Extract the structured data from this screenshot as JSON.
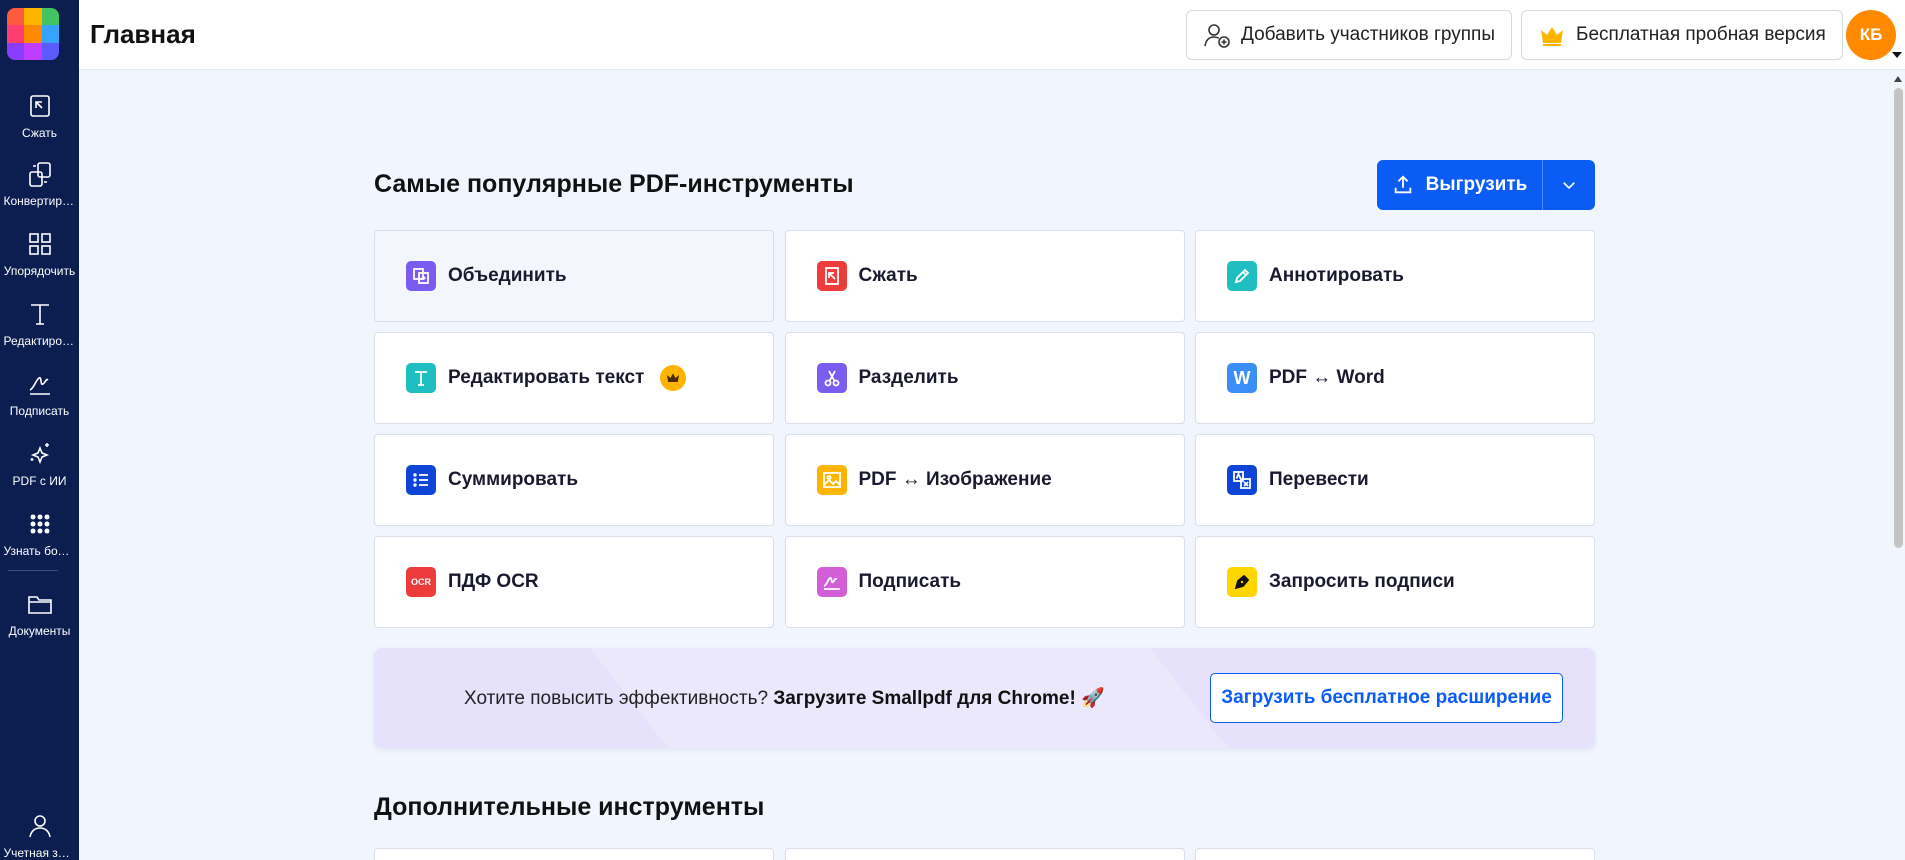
{
  "app": {
    "page_title": "Главная"
  },
  "sidebar": {
    "items": [
      {
        "label": "Сжать",
        "icon": "compress-icon"
      },
      {
        "label": "Конвертировать",
        "icon": "convert-icon"
      },
      {
        "label": "Упорядочить",
        "icon": "organize-icon"
      },
      {
        "label": "Редактировать",
        "icon": "edit-text-icon"
      },
      {
        "label": "Подписать",
        "icon": "sign-icon"
      },
      {
        "label": "PDF с ИИ",
        "icon": "ai-sparkle-icon"
      },
      {
        "label": "Узнать больше",
        "icon": "apps-grid-icon"
      },
      {
        "label": "Документы",
        "icon": "folder-icon"
      },
      {
        "label": "Учетная запись",
        "icon": "user-icon"
      }
    ]
  },
  "header": {
    "add_members_label": "Добавить участников группы",
    "trial_label": "Бесплатная пробная версия",
    "avatar_initials": "КБ"
  },
  "main": {
    "popular_title": "Самые популярные PDF-инструменты",
    "upload_label": "Выгрузить",
    "tools": [
      {
        "label": "Объединить",
        "icon": "merge-icon",
        "color": "#7b5cf0"
      },
      {
        "label": "Сжать",
        "icon": "compress-icon",
        "color": "#ee3b3b"
      },
      {
        "label": "Аннотировать",
        "icon": "annotate-pen-icon",
        "color": "#1fbfc1"
      },
      {
        "label": "Редактировать текст",
        "icon": "text-t-icon",
        "color": "#1fbfc1",
        "premium": true
      },
      {
        "label": "Разделить",
        "icon": "scissors-icon",
        "color": "#7b5cf0"
      },
      {
        "label": "PDF ↔ Word",
        "icon": "word-w-icon",
        "color": "#3a8ef5"
      },
      {
        "label": "Суммировать",
        "icon": "list-icon",
        "color": "#0f45d6"
      },
      {
        "label": "PDF ↔ Изображение",
        "icon": "image-icon",
        "color": "#ffb400"
      },
      {
        "label": "Перевести",
        "icon": "translate-icon",
        "color": "#0f45d6"
      },
      {
        "label": "ПДФ OCR",
        "icon": "ocr-icon",
        "color": "#ee3b3b"
      },
      {
        "label": "Подписать",
        "icon": "signature-icon",
        "color": "#d35ed8"
      },
      {
        "label": "Запросить подписи",
        "icon": "fountain-pen-icon",
        "color": "#ffd600"
      }
    ],
    "banner": {
      "text_plain": "Хотите повысить эффективность?",
      "text_bold": "Загрузите Smallpdf для Chrome!",
      "emoji": "🚀",
      "cta_label": "Загрузить бесплатное расширение"
    },
    "more_title": "Дополнительные инструменты"
  }
}
